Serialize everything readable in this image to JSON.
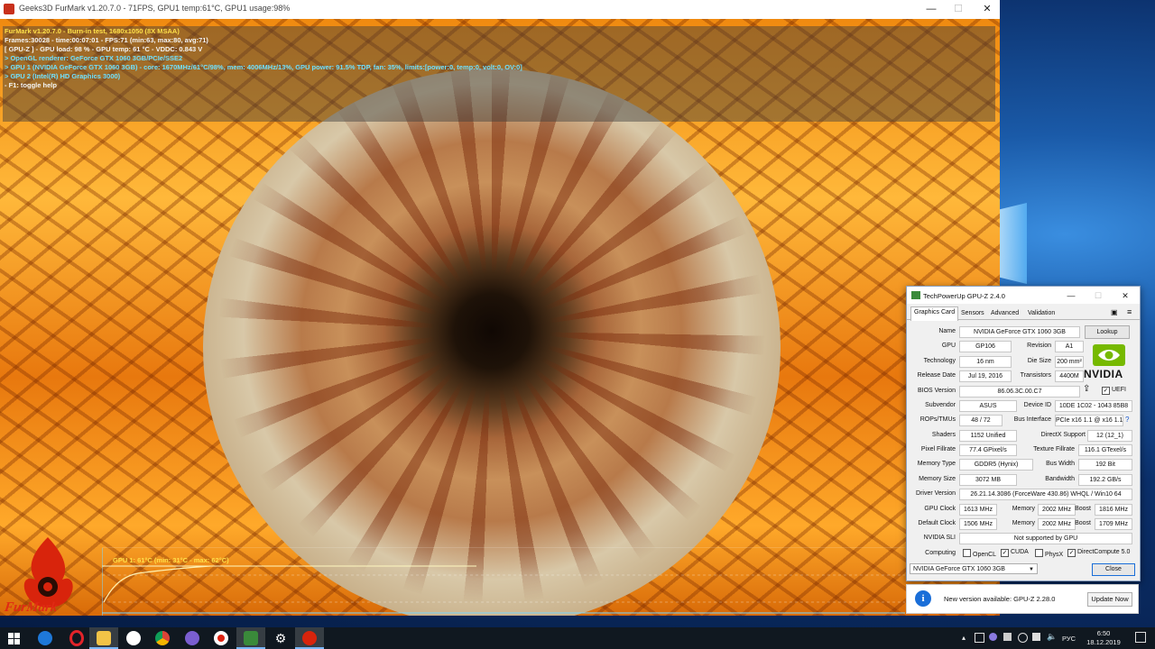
{
  "furmark": {
    "title": "Geeks3D FurMark v1.20.7.0 - 71FPS, GPU1 temp:61°C, GPU1 usage:98%",
    "osd": [
      {
        "text": "FurMark v1.20.7.0 - Burn-in test, 1680x1050 (8X MSAA)",
        "color": "yellow"
      },
      {
        "text": "Frames:30028 - time:00:07:01 - FPS:71 (min:63, max:80, avg:71)",
        "color": "white"
      },
      {
        "text": "[ GPU-Z ] - GPU load: 98 % - GPU temp: 61 °C - VDDC: 0.843 V",
        "color": "white"
      },
      {
        "text": "> OpenGL renderer: GeForce GTX 1060 3GB/PCIe/SSE2",
        "color": "cyan"
      },
      {
        "text": "> GPU 1 (NVIDIA GeForce GTX 1060 3GB) - core: 1670MHz/61°C/98%, mem: 4006MHz/13%, GPU power: 91.5% TDP, fan: 35%, limits:[power:0, temp:0, volt:0, OV:0]",
        "color": "cyan"
      },
      {
        "text": "> GPU 2 (Intel(R) HD Graphics 3000)",
        "color": "cyan"
      },
      {
        "text": "- F1: toggle help",
        "color": "white"
      }
    ],
    "graph_label": "GPU 1: 61°C (min: 31°C - max: 62°C)",
    "logo_text": "FurMark"
  },
  "gpuz": {
    "title": "TechPowerUp GPU-Z 2.4.0",
    "tabs": [
      "Graphics Card",
      "Sensors",
      "Advanced",
      "Validation"
    ],
    "active_tab": "Graphics Card",
    "lookup": "Lookup",
    "labels": {
      "name": "Name",
      "gpu": "GPU",
      "revision": "Revision",
      "technology": "Technology",
      "die_size": "Die Size",
      "release_date": "Release Date",
      "transistors": "Transistors",
      "bios_version": "BIOS Version",
      "subvendor": "Subvendor",
      "device_id": "Device ID",
      "rops": "ROPs/TMUs",
      "bus_interface": "Bus Interface",
      "shaders": "Shaders",
      "directx": "DirectX Support",
      "pixel_fillrate": "Pixel Fillrate",
      "texture_fillrate": "Texture Fillrate",
      "memory_type": "Memory Type",
      "bus_width": "Bus Width",
      "memory_size": "Memory Size",
      "bandwidth": "Bandwidth",
      "driver_version": "Driver Version",
      "gpu_clock": "GPU Clock",
      "memory": "Memory",
      "boost": "Boost",
      "default_clock": "Default Clock",
      "nvidia_sli": "NVIDIA SLI",
      "computing": "Computing"
    },
    "values": {
      "name": "NVIDIA GeForce GTX 1060 3GB",
      "gpu": "GP106",
      "revision": "A1",
      "technology": "16 nm",
      "die_size": "200 mm²",
      "release_date": "Jul 19, 2016",
      "transistors": "4400M",
      "bios_version": "86.06.3C.00.C7",
      "uefi": "UEFI",
      "subvendor": "ASUS",
      "device_id": "10DE 1C02 - 1043 85B8",
      "rops": "48 / 72",
      "bus_interface": "PCIe x16 1.1 @ x16 1.1",
      "bus_help": "?",
      "shaders": "1152 Unified",
      "directx": "12 (12_1)",
      "pixel_fillrate": "77.4 GPixel/s",
      "texture_fillrate": "116.1 GTexel/s",
      "memory_type": "GDDR5 (Hynix)",
      "bus_width": "192 Bit",
      "memory_size": "3072 MB",
      "bandwidth": "192.2 GB/s",
      "driver_version": "26.21.14.3086 (ForceWare 430.86) WHQL / Win10 64",
      "gpu_clock": "1613 MHz",
      "gpu_memory": "2002 MHz",
      "gpu_boost": "1816 MHz",
      "default_clock": "1506 MHz",
      "default_memory": "2002 MHz",
      "default_boost": "1709 MHz",
      "nvidia_sli": "Not supported by GPU"
    },
    "computing": [
      {
        "label": "OpenCL",
        "checked": false
      },
      {
        "label": "CUDA",
        "checked": true
      },
      {
        "label": "PhysX",
        "checked": false
      },
      {
        "label": "DirectCompute 5.0",
        "checked": true
      }
    ],
    "nvidia_logo_text": "NVIDIA",
    "gpu_select": "NVIDIA GeForce GTX 1060 3GB",
    "close": "Close"
  },
  "notification": {
    "icon": "i",
    "text": "New version available: GPU-Z 2.28.0",
    "button": "Update Now"
  },
  "taskbar": {
    "apps": [
      "windows-start-icon",
      "edge-icon",
      "opera-icon",
      "file-explorer-icon",
      "yandex-browser-icon",
      "chrome-icon",
      "viber-icon",
      "record-icon",
      "gpuz-taskbar-icon",
      "settings-icon",
      "furmark-taskbar-icon"
    ],
    "tray_lang": "РУС",
    "time": "6:50",
    "date": "18.12.2019"
  },
  "colors": {
    "accent": "#1a6ed8",
    "osd_yellow": "#ffe14a",
    "osd_cyan": "#6fe0ff",
    "nvidia_green": "#76b900"
  }
}
